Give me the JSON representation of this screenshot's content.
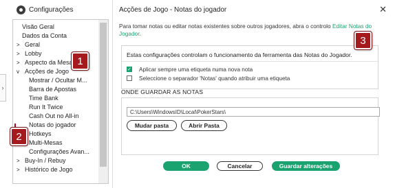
{
  "left_window": {
    "title": "Configurações",
    "edge_arrow": "›"
  },
  "tree": {
    "items": [
      {
        "label": "Visão Geral",
        "level": 0,
        "arrow": ""
      },
      {
        "label": "Dados da Conta",
        "level": 0,
        "arrow": ""
      },
      {
        "label": "Geral",
        "level": 0,
        "arrow": ">"
      },
      {
        "label": "Lobby",
        "level": 0,
        "arrow": ">"
      },
      {
        "label": "Aspecto da Mesa",
        "level": 0,
        "arrow": ">"
      },
      {
        "label": "Acções de Jogo",
        "level": 0,
        "arrow": "v"
      },
      {
        "label": "Mostrar / Ocultar M...",
        "level": 1,
        "arrow": ""
      },
      {
        "label": "Barra de Apostas",
        "level": 1,
        "arrow": ""
      },
      {
        "label": "Time Bank",
        "level": 1,
        "arrow": ""
      },
      {
        "label": "Run It Twice",
        "level": 1,
        "arrow": ""
      },
      {
        "label": "Cash Out no All-in",
        "level": 1,
        "arrow": ""
      },
      {
        "label": "Notas do jogador",
        "level": 1,
        "arrow": ""
      },
      {
        "label": "Hotkeys",
        "level": 1,
        "arrow": ""
      },
      {
        "label": "Multi-Mesas",
        "level": 1,
        "arrow": ""
      },
      {
        "label": "Configurações Avan...",
        "level": 1,
        "arrow": ""
      },
      {
        "label": "Buy-In / Rebuy",
        "level": 0,
        "arrow": ">"
      },
      {
        "label": "Histórico de Jogo",
        "level": 0,
        "arrow": ">"
      }
    ],
    "selected_index": 11
  },
  "right_window": {
    "title": "Acções de Jogo - Notas do jogador",
    "close_glyph": "✕"
  },
  "intro": {
    "text": "Para tomar notas ou editar notas existentes sobre outros jogadores, abra o controlo ",
    "link": "Editar Notas do Jogador",
    "end": "."
  },
  "settings_box": {
    "description": "Estas configurações controlam o funcionamento da ferramenta das Notas do Jogador.",
    "checkboxes": [
      {
        "label": "Aplicar sempre uma etiqueta numa nova nota",
        "checked": true
      },
      {
        "label": "Seleccione o separador 'Notas' quando atribuir uma etiqueta",
        "checked": false
      }
    ]
  },
  "save_location": {
    "title": "ONDE GUARDAR AS NOTAS",
    "path_value": "C:\\Users\\WindowsID\\Local\\PokerStars\\",
    "change_button": "Mudar pasta",
    "open_button": "Abrir Pasta"
  },
  "footer": {
    "ok": "OK",
    "cancel": "Cancelar",
    "save": "Guardar alterações"
  },
  "badges": [
    "1",
    "2",
    "3"
  ],
  "colors": {
    "accent_green": "#1aa36f",
    "badge_red": "#a51a1d"
  }
}
